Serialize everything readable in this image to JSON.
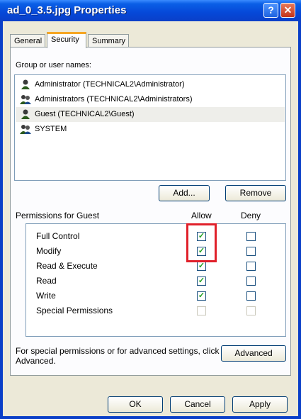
{
  "window": {
    "title": "ad_0_3.5.jpg Properties"
  },
  "titlebar": {
    "help_label": "?",
    "close_label": "✕"
  },
  "tabs": [
    {
      "label": "General"
    },
    {
      "label": "Security"
    },
    {
      "label": "Summary"
    }
  ],
  "groups": {
    "label": "Group or user names:",
    "items": [
      {
        "label": "Administrator (TECHNICAL2\\Administrator)",
        "icon": "user-icon"
      },
      {
        "label": "Administrators (TECHNICAL2\\Administrators)",
        "icon": "group-icon"
      },
      {
        "label": "Guest (TECHNICAL2\\Guest)",
        "icon": "user-icon"
      },
      {
        "label": "SYSTEM",
        "icon": "group-icon"
      }
    ],
    "add_label": "Add...",
    "remove_label": "Remove"
  },
  "permissions": {
    "label": "Permissions for Guest",
    "allow_header": "Allow",
    "deny_header": "Deny",
    "rows": [
      {
        "name": "Full Control",
        "allow": true,
        "deny": false
      },
      {
        "name": "Modify",
        "allow": true,
        "deny": false
      },
      {
        "name": "Read & Execute",
        "allow": true,
        "deny": false
      },
      {
        "name": "Read",
        "allow": true,
        "deny": false
      },
      {
        "name": "Write",
        "allow": true,
        "deny": false
      },
      {
        "name": "Special Permissions",
        "allow": false,
        "deny": false,
        "disabled": true
      }
    ]
  },
  "advanced": {
    "text": "For special permissions or for advanced settings, click Advanced.",
    "button_label": "Advanced"
  },
  "buttons": {
    "ok": "OK",
    "cancel": "Cancel",
    "apply": "Apply"
  },
  "colors": {
    "highlight": "#e0202a",
    "check": "#21a121",
    "title_bar": "#0548d8"
  }
}
